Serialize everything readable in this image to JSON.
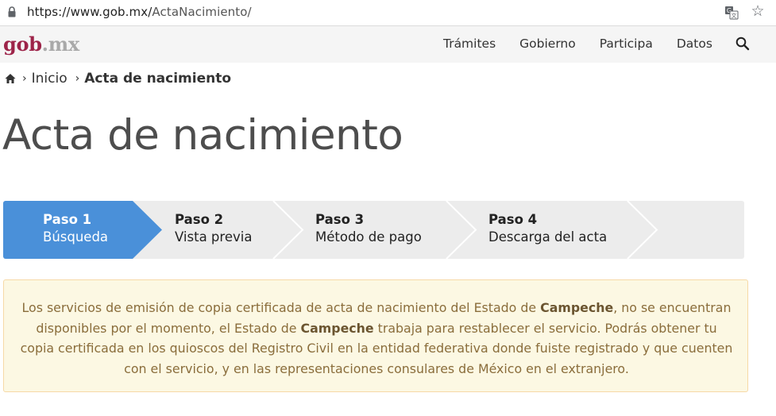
{
  "browser": {
    "url_host": "https://www.gob.mx/",
    "url_path": "ActaNacimiento/",
    "icons": [
      "lock-icon",
      "translate-icon",
      "star-icon"
    ]
  },
  "nav": {
    "logo_main": "gob",
    "logo_dot": ".",
    "logo_tld": "mx",
    "links": [
      "Trámites",
      "Gobierno",
      "Participa",
      "Datos"
    ],
    "search_icon": "search-icon"
  },
  "breadcrumb": {
    "home_icon": "home-icon",
    "items": [
      "Inicio",
      "Acta de nacimiento"
    ]
  },
  "page": {
    "title": "Acta de nacimiento"
  },
  "stepper": {
    "steps": [
      {
        "number": "Paso 1",
        "label": "Búsqueda",
        "active": true
      },
      {
        "number": "Paso 2",
        "label": "Vista previa",
        "active": false
      },
      {
        "number": "Paso 3",
        "label": "Método de pago",
        "active": false
      },
      {
        "number": "Paso 4",
        "label": "Descarga del acta",
        "active": false
      }
    ],
    "colors": {
      "active": "#4a90d9",
      "inactive": "#ececec",
      "separator": "#ffffff"
    }
  },
  "alert": {
    "line1_a": "Los servicios de emisión de copia certificada de acta de nacimiento del Estado de ",
    "state1": "Campeche",
    "line1_b": ", no se encuentran",
    "line2_a": "disponibles por el momento, el Estado de ",
    "state2": "Campeche",
    "line2_b": " trabaja para restablecer el servicio. Podrás obtener tu",
    "line3": "copia certificada en los quioscos del Registro Civil en la entidad federativa donde fuiste registrado y que cuenten",
    "line4": "con el servicio, y en las representaciones consulares de México en el extranjero.",
    "colors": {
      "background": "#fcf8e3",
      "border": "#f6d9a6",
      "text": "#8a6d3b"
    }
  }
}
